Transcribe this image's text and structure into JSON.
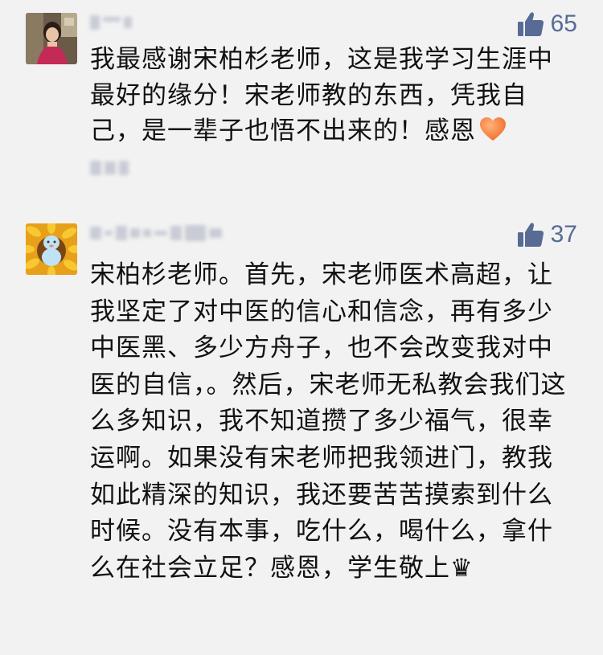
{
  "comments": [
    {
      "likes": "65",
      "text": "我最感谢宋柏杉老师，这是我学习生涯中最好的缘分！宋老师教的东西，凭我自己，是一辈子也悟不出来的！感恩"
    },
    {
      "likes": "37",
      "text": "宋柏杉老师。首先，宋老师医术高超，让我坚定了对中医的信心和信念，再有多少中医黑、多少方舟子，也不会改变我对中医的自信，。然后，宋老师无私教会我们这么多知识，我不知道攒了多少福气，很幸运啊。如果没有宋老师把我领进门，教我如此精深的知识，我还要苦苦摸索到什么时候。没有本事，吃什么，喝什么，拿什么在社会立足？感恩，学生敬上♛"
    }
  ],
  "icons": {
    "like": "thumbs-up-icon",
    "emoji": "heart-icon"
  },
  "colors": {
    "background": "#f2f2f2",
    "accent": "#576b95",
    "text": "#111111",
    "heart": "#f06a2a"
  }
}
